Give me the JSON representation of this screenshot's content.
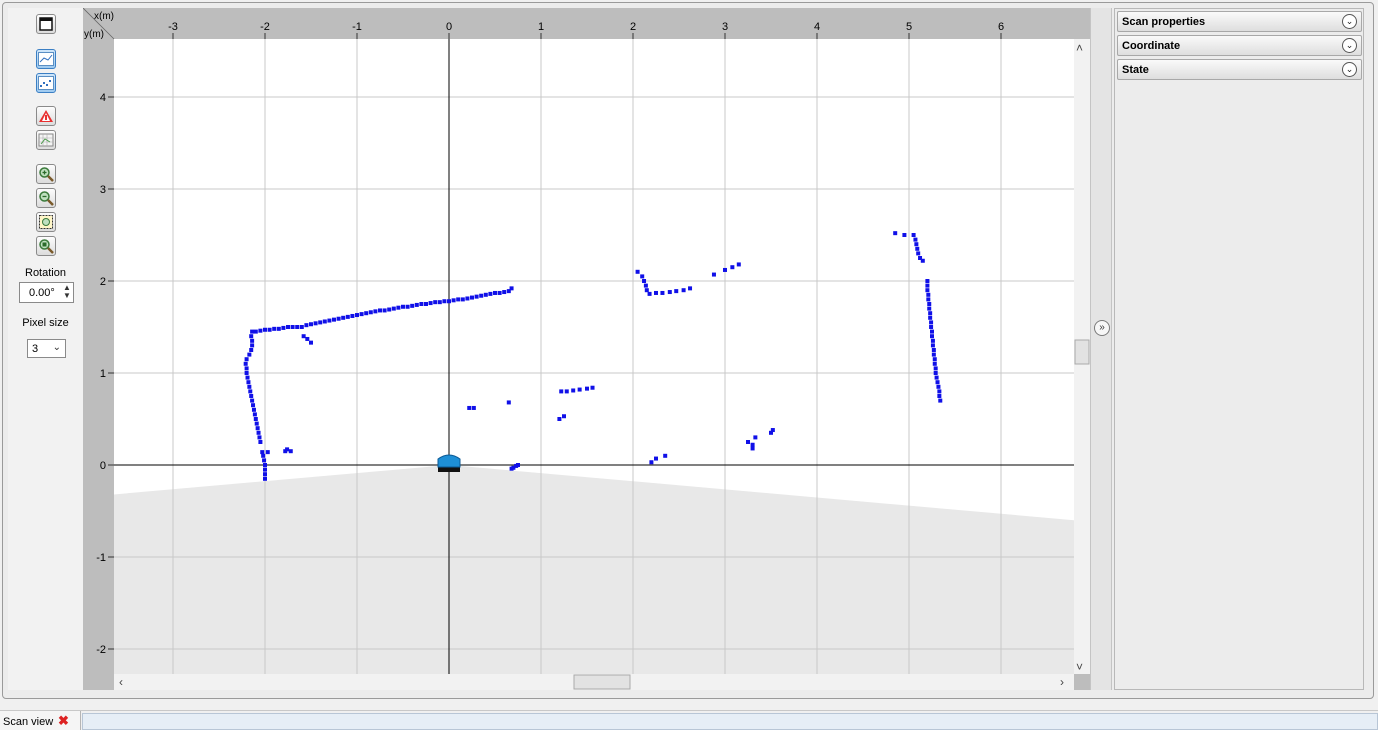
{
  "toolbar": {
    "buttons": [
      {
        "name": "window-icon"
      },
      {
        "name": "line-plot-icon"
      },
      {
        "name": "scatter-plot-icon"
      },
      {
        "name": "robot-warning-icon"
      },
      {
        "name": "grid-area-icon"
      },
      {
        "name": "zoom-in-icon"
      },
      {
        "name": "zoom-out-icon"
      },
      {
        "name": "zoom-fit-icon"
      },
      {
        "name": "zoom-reset-icon"
      }
    ],
    "rotation_label": "Rotation",
    "rotation_value": "0.00°",
    "pixel_size_label": "Pixel size",
    "pixel_size_value": "3"
  },
  "plot": {
    "x_axis_label": "x(m)",
    "y_axis_label": "y(m)",
    "x_ticks": [
      "-3",
      "-2",
      "-1",
      "0",
      "1",
      "2",
      "3",
      "4",
      "5",
      "6"
    ],
    "y_ticks": [
      "4",
      "3",
      "2",
      "1",
      "0",
      "-1",
      "-2"
    ],
    "point_color": "#1010e8",
    "scan_area_color": "#e8e8e8",
    "robot_color": "#1e8fd6",
    "points": [
      [
        -2.0,
        -0.15
      ],
      [
        -2.0,
        -0.1
      ],
      [
        -2.0,
        -0.05
      ],
      [
        -2.0,
        0.0
      ],
      [
        -2.01,
        0.05
      ],
      [
        -2.02,
        0.1
      ],
      [
        -2.03,
        0.14
      ],
      [
        -1.97,
        0.14
      ],
      [
        -1.76,
        0.17
      ],
      [
        -1.72,
        0.15
      ],
      [
        -1.78,
        0.15
      ],
      [
        -2.05,
        0.25
      ],
      [
        -2.06,
        0.3
      ],
      [
        -2.07,
        0.35
      ],
      [
        -2.08,
        0.4
      ],
      [
        -2.09,
        0.45
      ],
      [
        -2.1,
        0.5
      ],
      [
        -2.11,
        0.55
      ],
      [
        -2.12,
        0.6
      ],
      [
        -2.13,
        0.65
      ],
      [
        -2.14,
        0.7
      ],
      [
        -2.15,
        0.75
      ],
      [
        -2.16,
        0.8
      ],
      [
        -2.17,
        0.85
      ],
      [
        -2.18,
        0.9
      ],
      [
        -2.19,
        0.95
      ],
      [
        -2.2,
        1.0
      ],
      [
        -2.2,
        1.05
      ],
      [
        -2.21,
        1.1
      ],
      [
        -2.2,
        1.15
      ],
      [
        -2.17,
        1.2
      ],
      [
        -2.15,
        1.25
      ],
      [
        -2.14,
        1.3
      ],
      [
        -2.14,
        1.35
      ],
      [
        -2.15,
        1.4
      ],
      [
        -2.14,
        1.45
      ],
      [
        -2.1,
        1.45
      ],
      [
        -2.05,
        1.46
      ],
      [
        -2.0,
        1.47
      ],
      [
        -1.95,
        1.47
      ],
      [
        -1.9,
        1.48
      ],
      [
        -1.85,
        1.48
      ],
      [
        -1.8,
        1.49
      ],
      [
        -1.75,
        1.5
      ],
      [
        -1.7,
        1.5
      ],
      [
        -1.65,
        1.5
      ],
      [
        -1.6,
        1.5
      ],
      [
        -1.55,
        1.52
      ],
      [
        -1.5,
        1.53
      ],
      [
        -1.45,
        1.54
      ],
      [
        -1.4,
        1.55
      ],
      [
        -1.35,
        1.56
      ],
      [
        -1.3,
        1.57
      ],
      [
        -1.25,
        1.58
      ],
      [
        -1.2,
        1.59
      ],
      [
        -1.15,
        1.6
      ],
      [
        -1.1,
        1.61
      ],
      [
        -1.05,
        1.62
      ],
      [
        -1.0,
        1.63
      ],
      [
        -0.95,
        1.64
      ],
      [
        -0.9,
        1.65
      ],
      [
        -0.85,
        1.66
      ],
      [
        -0.8,
        1.67
      ],
      [
        -0.75,
        1.68
      ],
      [
        -0.7,
        1.68
      ],
      [
        -0.65,
        1.69
      ],
      [
        -0.6,
        1.7
      ],
      [
        -0.55,
        1.71
      ],
      [
        -0.5,
        1.72
      ],
      [
        -0.45,
        1.72
      ],
      [
        -0.4,
        1.73
      ],
      [
        -0.35,
        1.74
      ],
      [
        -0.3,
        1.75
      ],
      [
        -0.25,
        1.75
      ],
      [
        -0.2,
        1.76
      ],
      [
        -0.15,
        1.77
      ],
      [
        -0.1,
        1.77
      ],
      [
        -0.05,
        1.78
      ],
      [
        0.0,
        1.78
      ],
      [
        0.05,
        1.79
      ],
      [
        0.1,
        1.8
      ],
      [
        0.15,
        1.8
      ],
      [
        0.2,
        1.81
      ],
      [
        0.25,
        1.82
      ],
      [
        0.3,
        1.83
      ],
      [
        0.35,
        1.84
      ],
      [
        0.4,
        1.85
      ],
      [
        0.45,
        1.86
      ],
      [
        0.5,
        1.87
      ],
      [
        0.55,
        1.87
      ],
      [
        0.6,
        1.88
      ],
      [
        0.65,
        1.89
      ],
      [
        0.68,
        1.92
      ],
      [
        -1.58,
        1.4
      ],
      [
        -1.54,
        1.37
      ],
      [
        -1.5,
        1.33
      ],
      [
        0.22,
        0.62
      ],
      [
        0.27,
        0.62
      ],
      [
        0.65,
        0.68
      ],
      [
        0.7,
        -0.03
      ],
      [
        0.73,
        -0.01
      ],
      [
        0.68,
        -0.04
      ],
      [
        0.75,
        0.0
      ],
      [
        1.2,
        0.5
      ],
      [
        1.25,
        0.53
      ],
      [
        1.22,
        0.8
      ],
      [
        1.28,
        0.8
      ],
      [
        1.35,
        0.81
      ],
      [
        1.42,
        0.82
      ],
      [
        1.5,
        0.83
      ],
      [
        1.56,
        0.84
      ],
      [
        2.2,
        0.03
      ],
      [
        2.25,
        0.07
      ],
      [
        2.35,
        0.1
      ],
      [
        2.05,
        2.1
      ],
      [
        2.1,
        2.05
      ],
      [
        2.12,
        2.0
      ],
      [
        2.14,
        1.95
      ],
      [
        2.15,
        1.9
      ],
      [
        2.18,
        1.86
      ],
      [
        2.25,
        1.87
      ],
      [
        2.32,
        1.87
      ],
      [
        2.4,
        1.88
      ],
      [
        2.47,
        1.89
      ],
      [
        2.55,
        1.9
      ],
      [
        2.62,
        1.92
      ],
      [
        2.88,
        2.07
      ],
      [
        3.0,
        2.12
      ],
      [
        3.08,
        2.15
      ],
      [
        3.15,
        2.18
      ],
      [
        3.25,
        0.25
      ],
      [
        3.3,
        0.22
      ],
      [
        3.33,
        0.3
      ],
      [
        3.3,
        0.18
      ],
      [
        3.5,
        0.35
      ],
      [
        3.52,
        0.38
      ],
      [
        4.85,
        2.52
      ],
      [
        4.95,
        2.5
      ],
      [
        5.05,
        2.5
      ],
      [
        5.07,
        2.45
      ],
      [
        5.08,
        2.4
      ],
      [
        5.09,
        2.35
      ],
      [
        5.1,
        2.3
      ],
      [
        5.12,
        2.25
      ],
      [
        5.15,
        2.22
      ],
      [
        5.2,
        2.0
      ],
      [
        5.2,
        1.95
      ],
      [
        5.2,
        1.9
      ],
      [
        5.21,
        1.85
      ],
      [
        5.21,
        1.8
      ],
      [
        5.22,
        1.75
      ],
      [
        5.22,
        1.7
      ],
      [
        5.23,
        1.65
      ],
      [
        5.23,
        1.6
      ],
      [
        5.24,
        1.55
      ],
      [
        5.24,
        1.5
      ],
      [
        5.25,
        1.45
      ],
      [
        5.25,
        1.4
      ],
      [
        5.26,
        1.35
      ],
      [
        5.26,
        1.3
      ],
      [
        5.27,
        1.25
      ],
      [
        5.27,
        1.2
      ],
      [
        5.28,
        1.15
      ],
      [
        5.28,
        1.1
      ],
      [
        5.29,
        1.05
      ],
      [
        5.29,
        1.0
      ],
      [
        5.3,
        0.95
      ],
      [
        5.31,
        0.9
      ],
      [
        5.32,
        0.85
      ],
      [
        5.33,
        0.8
      ],
      [
        5.33,
        0.75
      ],
      [
        5.34,
        0.7
      ]
    ]
  },
  "panel": {
    "sections": [
      {
        "title": "Scan properties"
      },
      {
        "title": "Coordinate"
      },
      {
        "title": "State"
      }
    ]
  },
  "bottom": {
    "tab_label": "Scan view"
  }
}
